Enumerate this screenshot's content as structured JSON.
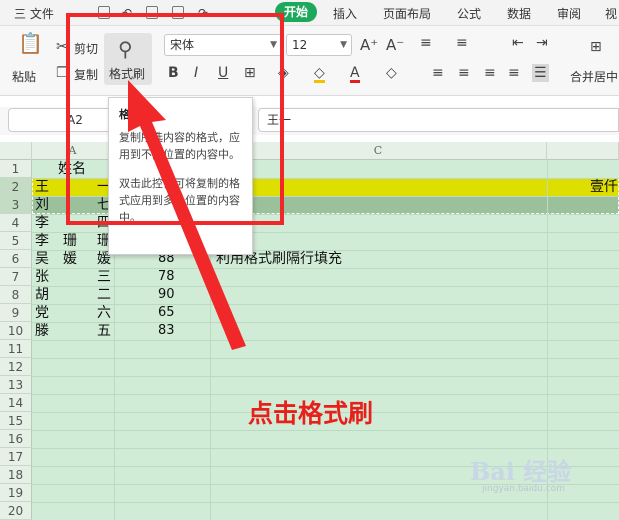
{
  "menu": {
    "file": "三 文件",
    "tabs": [
      "开始",
      "插入",
      "页面布局",
      "公式",
      "数据",
      "审阅",
      "视"
    ]
  },
  "ribbon": {
    "paste": "粘贴",
    "cut": "剪切",
    "copy": "复制",
    "format_painter": "格式刷",
    "font_name": "宋体",
    "font_size": "12",
    "bold": "B",
    "italic": "I",
    "underline": "U",
    "increase_font": "A⁺",
    "decrease_font": "A⁻",
    "merge_center": "合并居中"
  },
  "formula_bar": {
    "cell_ref": "A2",
    "content": "王一"
  },
  "sheet": {
    "columns": [
      "A",
      "C"
    ],
    "row_numbers": [
      "1",
      "2",
      "3",
      "4",
      "5",
      "6",
      "7",
      "8",
      "9",
      "10",
      "11",
      "12",
      "13",
      "14",
      "15",
      "16",
      "17",
      "18",
      "19",
      "20"
    ],
    "header_text": "姓名",
    "rows": [
      {
        "name": "王",
        "given": "一",
        "score": ""
      },
      {
        "name": "刘",
        "given": "七",
        "score": ""
      },
      {
        "name": "李",
        "given": "四",
        "score": ""
      },
      {
        "name": "李　珊",
        "given": "珊",
        "score": ""
      },
      {
        "name": "吴　媛",
        "given": "媛",
        "score": "88"
      },
      {
        "name": "张",
        "given": "三",
        "score": "78"
      },
      {
        "name": "胡",
        "given": "二",
        "score": "90"
      },
      {
        "name": "党",
        "given": "六",
        "score": "65"
      },
      {
        "name": "滕",
        "given": "五",
        "score": "83"
      }
    ],
    "note": "利用格式刷隔行填充",
    "right_cell": "壹仟"
  },
  "tooltip": {
    "title": "格式刷",
    "line1": "复制所选内容的格式，应用到不同位置的内容中。",
    "line2": "双击此控件可将复制的格式应用到多个位置的内容中。"
  },
  "annotation": "点击格式刷",
  "watermark": "Bai 经验",
  "watermark_url": "jingyan.baidu.com",
  "colors": {
    "accent": "#1ca95c",
    "highlight_row": "#dede00",
    "selected_row": "#9bc19b",
    "sheet_bg": "#d1ecd6",
    "annotation": "#e8201c"
  }
}
